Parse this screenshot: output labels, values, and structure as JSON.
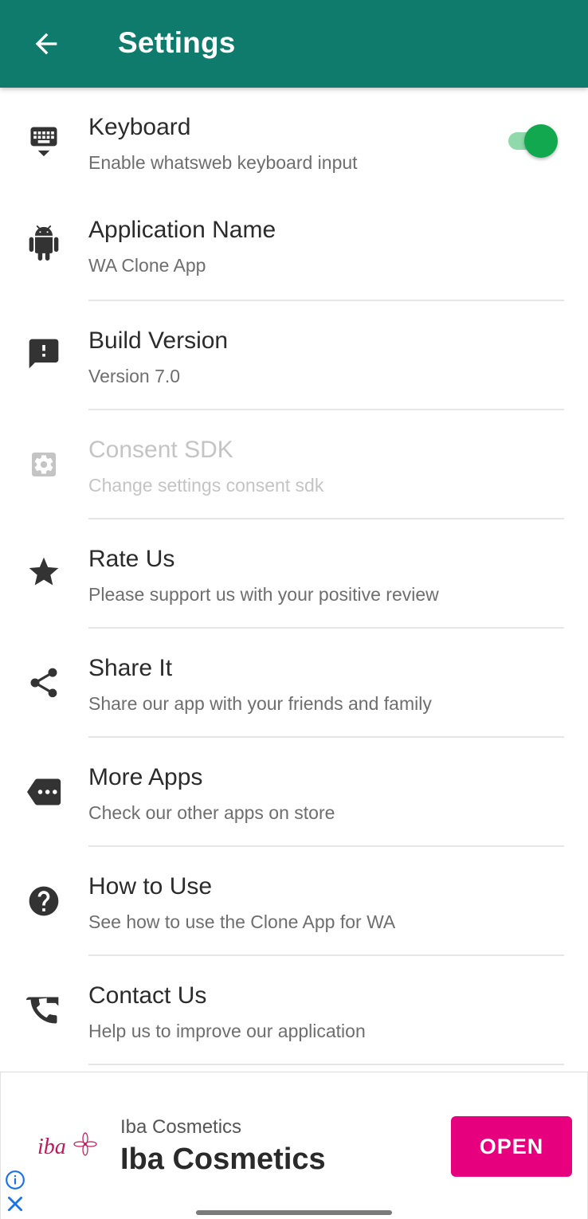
{
  "appbar": {
    "title": "Settings",
    "background": "#0f7b6c"
  },
  "settings": {
    "items": [
      {
        "icon": "keyboard-icon",
        "title": "Keyboard",
        "subtitle": "Enable whatsweb keyboard input",
        "toggle_on": true
      },
      {
        "icon": "android-icon",
        "title": "Application Name",
        "subtitle": "WA Clone App"
      },
      {
        "icon": "feedback-icon",
        "title": "Build Version",
        "subtitle": "Version 7.0"
      },
      {
        "icon": "gear-icon",
        "title": "Consent SDK",
        "subtitle": "Change settings consent sdk",
        "disabled": true
      },
      {
        "icon": "star-icon",
        "title": "Rate Us",
        "subtitle": "Please support us with your positive review"
      },
      {
        "icon": "share-icon",
        "title": "Share It",
        "subtitle": "Share our app with your friends and family"
      },
      {
        "icon": "more-apps-icon",
        "title": "More Apps",
        "subtitle": "Check our other apps on store"
      },
      {
        "icon": "help-icon",
        "title": "How to Use",
        "subtitle": "See how to use the Clone App for WA"
      },
      {
        "icon": "contact-phone-icon",
        "title": "Contact Us",
        "subtitle": "Help us to improve our application"
      }
    ]
  },
  "ad": {
    "logo_text": "iba",
    "advertiser_small": "Iba Cosmetics",
    "advertiser_big": "Iba Cosmetics",
    "cta": "OPEN",
    "cta_color": "#e6007e"
  },
  "colors": {
    "toggle_knob": "#11a84f",
    "toggle_track": "#8fd9ab",
    "icon": "#333333"
  }
}
